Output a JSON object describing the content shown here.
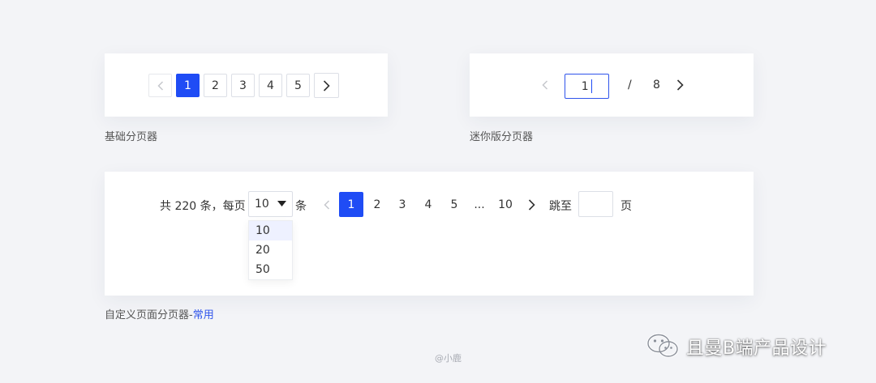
{
  "basic_pager": {
    "pages": [
      "1",
      "2",
      "3",
      "4",
      "5"
    ],
    "active_page": "1",
    "caption": "基础分页器"
  },
  "mini_pager": {
    "current_value": "1",
    "separator": "/",
    "total_pages": "8",
    "caption": "迷你版分页器"
  },
  "custom_pager": {
    "total_label": "共 220 条，每页",
    "page_size": "10",
    "page_size_options": [
      "10",
      "20",
      "50"
    ],
    "per_unit": "条",
    "pages": [
      "1",
      "2",
      "3",
      "4",
      "5",
      "...",
      "10"
    ],
    "active_page": "1",
    "jump_label": "跳至",
    "page_unit": "页",
    "caption_prefix": "自定义页面分页器-",
    "caption_highlight": "常用"
  },
  "credit": "@小鹿",
  "brand": "且曼B端产品设计",
  "colors": {
    "primary": "#1f4cf5",
    "highlight_text": "#2f54eb",
    "background": "#f3f4f7"
  },
  "icons": [
    "chevron-left-icon",
    "chevron-right-icon",
    "caret-down-icon",
    "wechat-icon"
  ]
}
